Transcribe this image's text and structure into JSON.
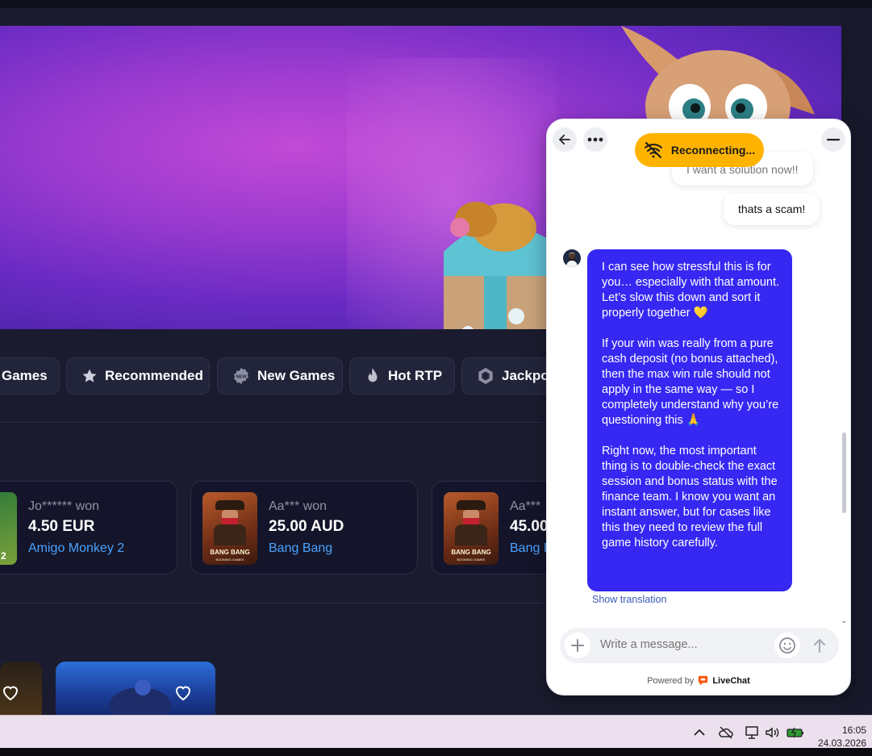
{
  "categories": [
    {
      "label": "Games",
      "icon": "gamepad-icon"
    },
    {
      "label": "Recommended",
      "icon": "star-icon"
    },
    {
      "label": "New Games",
      "icon": "new-badge-icon"
    },
    {
      "label": "Hot RTP",
      "icon": "flame-icon"
    },
    {
      "label": "Jackpo",
      "icon": "gem-icon"
    }
  ],
  "new_badge_text": "NEW",
  "wins": [
    {
      "who": "Jo****** won",
      "amount": "4.50 EUR",
      "game": "Amigo Monkey 2",
      "thumb_badge": "2"
    },
    {
      "who": "Aa*** won",
      "amount": "25.00 AUD",
      "game": "Bang Bang",
      "thumb_title": "BANG BANG",
      "thumb_sub": "BOOMING GAMES"
    },
    {
      "who": "Aa***",
      "amount": "45.00",
      "game": "Bang B",
      "thumb_title": "BANG BANG",
      "thumb_sub": "BOOMING GAMES"
    }
  ],
  "chat": {
    "status": "Reconnecting...",
    "messages_user": [
      "I want a solution now!!",
      "thats a scam!"
    ],
    "agent_message": [
      "I can see how stressful this is for you… especially with that amount. Let’s slow this down and sort it properly together 💛",
      "If your win was really from a pure cash deposit (no bonus attached), then the max win rule should not apply in the same way — so I completely understand why you’re questioning this 🙏",
      "Right now, the most important thing is to double-check the exact session and bonus status with the finance team. I know you want an instant answer, but for cases like this they need to review the full game history carefully."
    ],
    "show_translation": "Show translation",
    "composer_placeholder": "Write a message...",
    "powered_by": "Powered by",
    "brand": "LiveChat"
  },
  "taskbar": {
    "time": "16:05",
    "date": "24.03.2026"
  },
  "colors": {
    "agent_bubble": "#3628f2",
    "status_pill": "#ffb300",
    "link": "#4aa3ff",
    "page_bg": "#1a1b2e"
  }
}
